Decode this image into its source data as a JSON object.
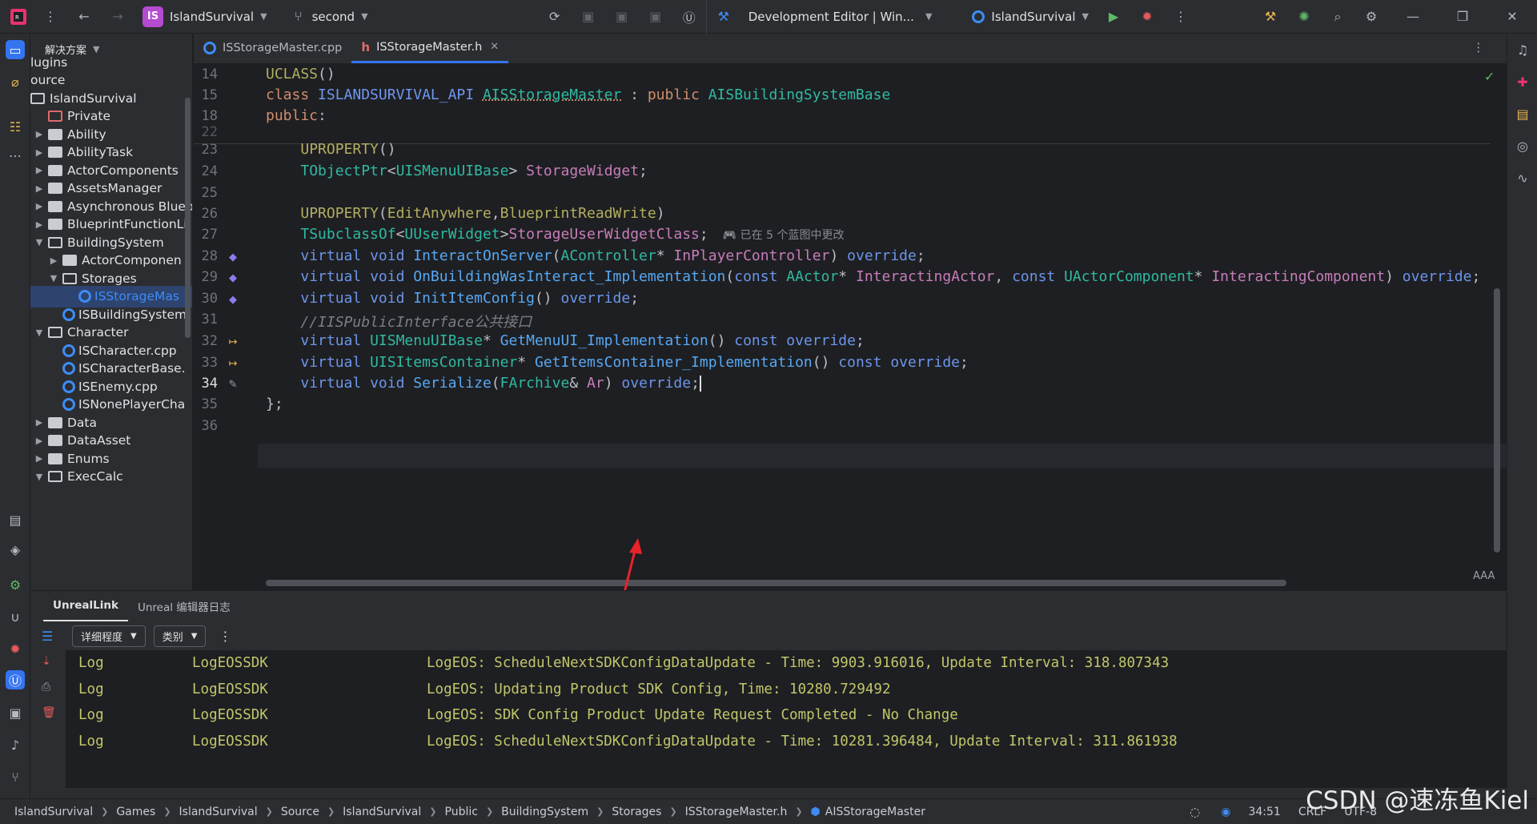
{
  "titlebar": {
    "project_badge": "IS",
    "project_name": "IslandSurvival",
    "branch": "second",
    "config": "Development Editor | Win...",
    "run_target": "IslandSurvival"
  },
  "project_panel": {
    "title": "解决方案",
    "items": [
      {
        "label": "lugins",
        "indent": 0,
        "kind": "plain"
      },
      {
        "label": "ource",
        "indent": 0,
        "kind": "plain"
      },
      {
        "label": "IslandSurvival",
        "indent": 0,
        "kind": "folder-open"
      },
      {
        "label": "Private",
        "indent": 1,
        "kind": "private"
      },
      {
        "label": "Ability",
        "indent": 2,
        "kind": "folder-closed"
      },
      {
        "label": "AbilityTask",
        "indent": 2,
        "kind": "folder-closed"
      },
      {
        "label": "ActorComponents",
        "indent": 2,
        "kind": "folder-closed"
      },
      {
        "label": "AssetsManager",
        "indent": 2,
        "kind": "folder-closed"
      },
      {
        "label": "Asynchronous Bluep",
        "indent": 2,
        "kind": "folder-closed"
      },
      {
        "label": "BlueprintFunctionLil",
        "indent": 2,
        "kind": "folder-closed"
      },
      {
        "label": "BuildingSystem",
        "indent": 2,
        "kind": "folder-open"
      },
      {
        "label": "ActorComponen",
        "indent": 3,
        "kind": "folder-closed"
      },
      {
        "label": "Storages",
        "indent": 3,
        "kind": "folder-open"
      },
      {
        "label": "ISStorageMas",
        "indent": 4,
        "kind": "cpp-selected"
      },
      {
        "label": "ISBuildingSystem",
        "indent": 3,
        "kind": "cpp"
      },
      {
        "label": "Character",
        "indent": 2,
        "kind": "folder-open"
      },
      {
        "label": "ISCharacter.cpp",
        "indent": 3,
        "kind": "cpp"
      },
      {
        "label": "ISCharacterBase.",
        "indent": 3,
        "kind": "cpp"
      },
      {
        "label": "ISEnemy.cpp",
        "indent": 3,
        "kind": "cpp"
      },
      {
        "label": "ISNonePlayerCha",
        "indent": 3,
        "kind": "cpp"
      },
      {
        "label": "Data",
        "indent": 2,
        "kind": "folder-closed"
      },
      {
        "label": "DataAsset",
        "indent": 2,
        "kind": "folder-closed"
      },
      {
        "label": "Enums",
        "indent": 2,
        "kind": "folder-closed"
      },
      {
        "label": "ExecCalc",
        "indent": 2,
        "kind": "folder-open"
      }
    ]
  },
  "tabs": [
    {
      "label": "ISStorageMaster.cpp",
      "active": false
    },
    {
      "label": "ISStorageMaster.h",
      "active": true
    }
  ],
  "editor": {
    "lines": [
      {
        "num": "14",
        "tokens": [
          [
            "macro",
            "UCLASS"
          ],
          [
            "pm",
            "()"
          ]
        ]
      },
      {
        "num": "15",
        "tokens": [
          [
            "kw",
            "class "
          ],
          [
            "purp",
            "ISLANDSURVIVAL_API "
          ],
          [
            "type uline",
            "AISStorageMaster"
          ],
          [
            "pm",
            " : "
          ],
          [
            "kw",
            "public "
          ],
          [
            "type",
            "AISBuildingSystemBase"
          ]
        ]
      },
      {
        "num": "18",
        "tokens": [
          [
            "kw",
            "public"
          ],
          [
            "pm",
            ":"
          ]
        ]
      },
      {
        "num": "22",
        "tokens": []
      },
      {
        "num": "23",
        "tokens": [
          [
            "pm",
            "    "
          ],
          [
            "macro",
            "UPROPERTY"
          ],
          [
            "pm",
            "()"
          ]
        ]
      },
      {
        "num": "24",
        "tokens": [
          [
            "pm",
            "    "
          ],
          [
            "type",
            "TObjectPtr"
          ],
          [
            "pm",
            "<"
          ],
          [
            "type",
            "UISMenuUIBase"
          ],
          [
            "pm",
            "> "
          ],
          [
            "vr",
            "StorageWidget"
          ],
          [
            "pm",
            ";"
          ]
        ]
      },
      {
        "num": "25",
        "tokens": []
      },
      {
        "num": "26",
        "tokens": [
          [
            "pm",
            "    "
          ],
          [
            "macro",
            "UPROPERTY"
          ],
          [
            "pm",
            "("
          ],
          [
            "macro",
            "EditAnywhere"
          ],
          [
            "pm",
            ","
          ],
          [
            "macro",
            "BlueprintReadWrite"
          ],
          [
            "pm",
            ")"
          ]
        ]
      },
      {
        "num": "27",
        "tokens": [
          [
            "pm",
            "    "
          ],
          [
            "type",
            "TSubclassOf"
          ],
          [
            "pm",
            "<"
          ],
          [
            "type",
            "UUserWidget"
          ],
          [
            "pm",
            ">"
          ],
          [
            "vr",
            "StorageUserWidgetClass"
          ],
          [
            "pm",
            ";"
          ]
        ],
        "hint": "🎮 已在 5 个蓝图中更改"
      },
      {
        "num": "28",
        "tokens": [
          [
            "pm",
            "    "
          ],
          [
            "kwb",
            "virtual "
          ],
          [
            "kwb",
            "void "
          ],
          [
            "fn",
            "InteractOnServer"
          ],
          [
            "pm",
            "("
          ],
          [
            "type",
            "AController"
          ],
          [
            "pm",
            "* "
          ],
          [
            "vr",
            "InPlayerController"
          ],
          [
            "pm",
            ") "
          ],
          [
            "kwb",
            "override"
          ],
          [
            "pm",
            ";"
          ]
        ]
      },
      {
        "num": "29",
        "tokens": [
          [
            "pm",
            "    "
          ],
          [
            "kwb",
            "virtual "
          ],
          [
            "kwb",
            "void "
          ],
          [
            "fn",
            "OnBuildingWasInteract_Implementation"
          ],
          [
            "pm",
            "("
          ],
          [
            "kwb",
            "const "
          ],
          [
            "type",
            "AActor"
          ],
          [
            "pm",
            "* "
          ],
          [
            "vr",
            "InteractingActor"
          ],
          [
            "pm",
            ", "
          ],
          [
            "kwb",
            "const "
          ],
          [
            "type",
            "UActorComponent"
          ],
          [
            "pm",
            "* "
          ],
          [
            "vr",
            "InteractingComponent"
          ],
          [
            "pm",
            ") "
          ],
          [
            "kwb",
            "override"
          ],
          [
            "pm",
            ";"
          ]
        ]
      },
      {
        "num": "30",
        "tokens": [
          [
            "pm",
            "    "
          ],
          [
            "kwb",
            "virtual "
          ],
          [
            "kwb",
            "void "
          ],
          [
            "fn",
            "InitItemConfig"
          ],
          [
            "pm",
            "() "
          ],
          [
            "kwb",
            "override"
          ],
          [
            "pm",
            ";"
          ]
        ]
      },
      {
        "num": "31",
        "tokens": [
          [
            "pm",
            "    "
          ],
          [
            "cm",
            "//IISPublicInterface公共接口"
          ]
        ]
      },
      {
        "num": "32",
        "tokens": [
          [
            "pm",
            "    "
          ],
          [
            "kwb",
            "virtual "
          ],
          [
            "type",
            "UISMenuUIBase"
          ],
          [
            "pm",
            "* "
          ],
          [
            "fn",
            "GetMenuUI_Implementation"
          ],
          [
            "pm",
            "() "
          ],
          [
            "kwb",
            "const "
          ],
          [
            "kwb",
            "override"
          ],
          [
            "pm",
            ";"
          ]
        ]
      },
      {
        "num": "33",
        "tokens": [
          [
            "pm",
            "    "
          ],
          [
            "kwb",
            "virtual "
          ],
          [
            "type",
            "UISItemsContainer"
          ],
          [
            "pm",
            "* "
          ],
          [
            "fn",
            "GetItemsContainer_Implementation"
          ],
          [
            "pm",
            "() "
          ],
          [
            "kwb",
            "const "
          ],
          [
            "kwb",
            "override"
          ],
          [
            "pm",
            ";"
          ]
        ]
      },
      {
        "num": "34",
        "tokens": [
          [
            "pm",
            "    "
          ],
          [
            "kwb",
            "virtual "
          ],
          [
            "kwb",
            "void "
          ],
          [
            "fn",
            "Serialize"
          ],
          [
            "pm",
            "("
          ],
          [
            "type",
            "FArchive"
          ],
          [
            "pm",
            "& "
          ],
          [
            "vr",
            "Ar"
          ],
          [
            "pm",
            ") "
          ],
          [
            "kwb",
            "override"
          ],
          [
            "pm",
            ";"
          ]
        ]
      },
      {
        "num": "35",
        "tokens": [
          [
            "pm",
            "};"
          ]
        ]
      },
      {
        "num": "36",
        "tokens": []
      }
    ]
  },
  "bottom_panel": {
    "tabs": [
      "UnrealLink",
      "Unreal 编辑器日志"
    ],
    "active_tab": "UnrealLink",
    "verbosity_dropdown": "详细程度",
    "category_dropdown": "类别",
    "log_rows": [
      {
        "level": "Log",
        "category": "LogEOSSDK",
        "message": "LogEOS: ScheduleNextSDKConfigDataUpdate - Time: 9903.916016, Update Interval: 318.807343"
      },
      {
        "level": "Log",
        "category": "LogEOSSDK",
        "message": "LogEOS: Updating Product SDK Config, Time: 10280.729492"
      },
      {
        "level": "Log",
        "category": "LogEOSSDK",
        "message": "LogEOS: SDK Config Product Update Request Completed - No Change"
      },
      {
        "level": "Log",
        "category": "LogEOSSDK",
        "message": "LogEOS: ScheduleNextSDKConfigDataUpdate - Time: 10281.396484, Update Interval: 311.861938"
      }
    ]
  },
  "statusbar": {
    "breadcrumbs": [
      "IslandSurvival",
      "Games",
      "IslandSurvival",
      "Source",
      "IslandSurvival",
      "Public",
      "BuildingSystem",
      "Storages",
      "ISStorageMaster.h",
      "AISStorageMaster"
    ],
    "position": "34:51",
    "line_ending": "CRLF",
    "encoding": "UTF-8"
  },
  "watermark": "CSDN @速冻鱼Kiel",
  "colors": {
    "accent": "#3574f0",
    "editor_bg": "#1e1f22",
    "panel_bg": "#2b2d30",
    "log_text": "#c2c66a"
  }
}
